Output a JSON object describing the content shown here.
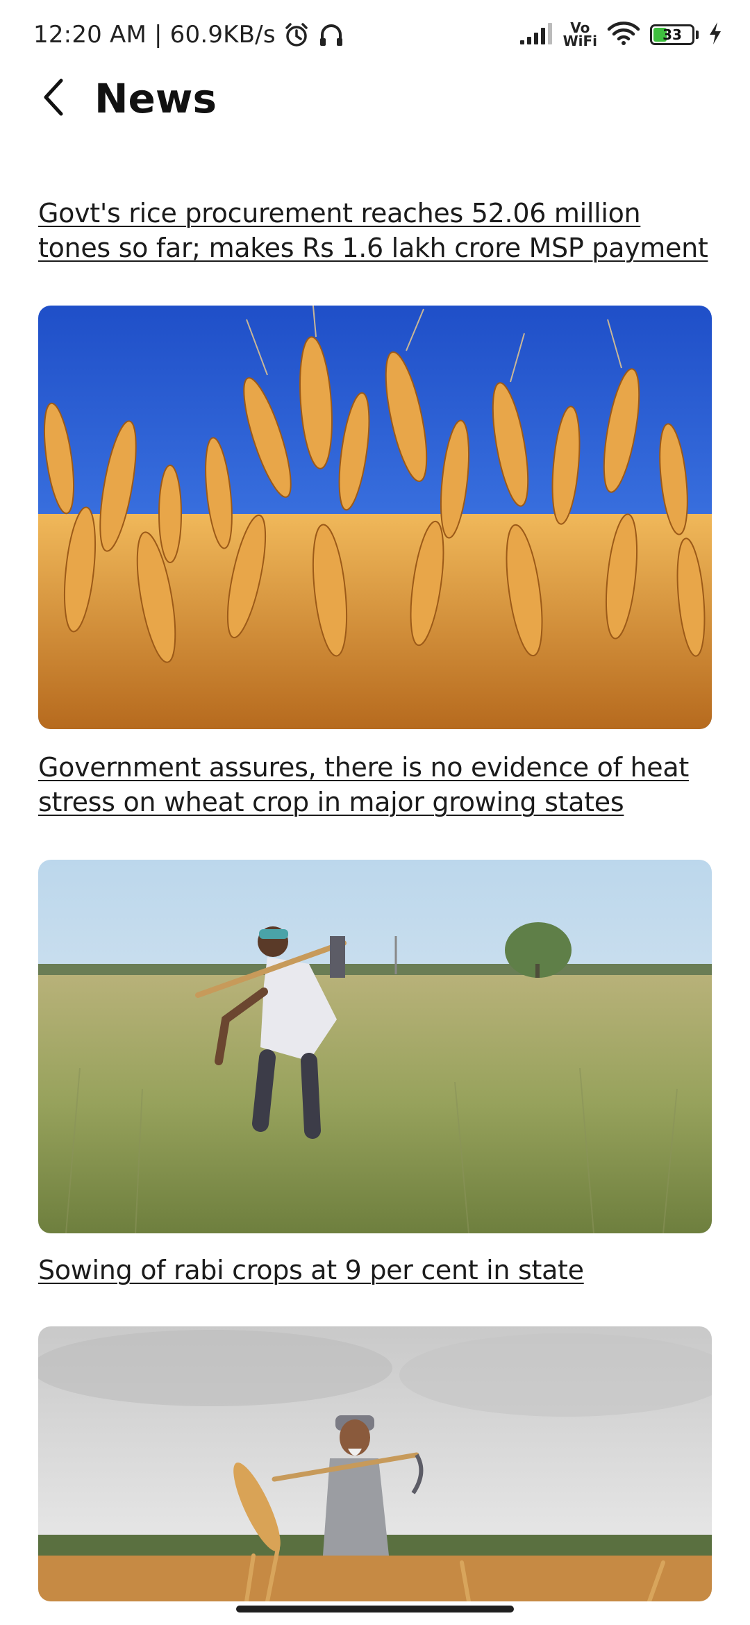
{
  "status_bar": {
    "time_speed": "12:20 AM | 60.9KB/s",
    "alarm_icon": "alarm-clock-icon",
    "headset_icon": "headphones-icon",
    "signal_icon": "signal-bars-icon",
    "vowifi_top": "Vo",
    "vowifi_bottom": "WiFi",
    "wifi_icon": "wifi-icon",
    "battery_level": "33",
    "battery_fraction": 0.33,
    "charging_icon": "lightning-bolt-icon"
  },
  "header": {
    "back_icon": "chevron-left-icon",
    "title": "News"
  },
  "news": [
    {
      "title_line1": "Govt's rice procurement reaches 52.06 million",
      "title_line2": "tones so far; makes Rs 1.6 lakh crore MSP payment",
      "image": "wheat-ears-blue-sky-photo"
    },
    {
      "title_line1": "Government assures, there is no evidence of heat",
      "title_line2": "stress on wheat crop in major growing states",
      "image": "farmer-bending-in-green-wheat-field-photo"
    },
    {
      "title_line1": "Sowing of rabi crops at 9 per cent in state",
      "image": "turbaned-farmer-with-sickle-in-field-photo"
    }
  ],
  "colors": {
    "text": "#1b1b1b",
    "battery_green": "#3fbf3f",
    "sky_blue": "#2f5fd0",
    "wheat_gold": "#d89a3a"
  }
}
